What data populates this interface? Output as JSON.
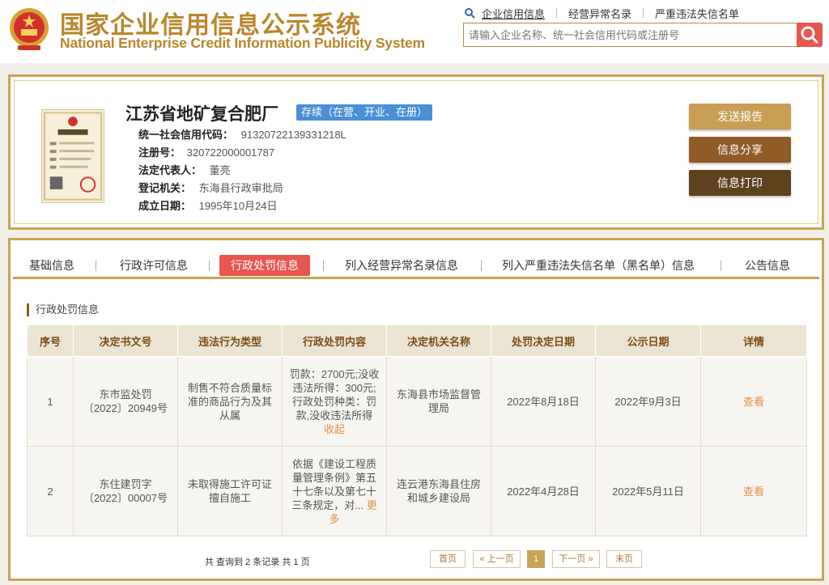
{
  "header": {
    "title_cn": "国家企业信用信息公示系统",
    "title_en": "National Enterprise Credit Information Publicity System",
    "links": [
      "企业信用信息",
      "经营异常名录",
      "严重违法失信名单"
    ],
    "search_placeholder": "请输入企业名称、统一社会信用代码或注册号"
  },
  "company": {
    "name": "江苏省地矿复合肥厂",
    "status": "存续（在营、开业、在册）",
    "fields": [
      {
        "label": "统一社会信用代码：",
        "value": "91320722139331218L"
      },
      {
        "label": "注册号：",
        "value": "320722000001787"
      },
      {
        "label": "法定代表人：",
        "value": "董亮"
      },
      {
        "label": "登记机关：",
        "value": "东海县行政审批局"
      },
      {
        "label": "成立日期：",
        "value": "1995年10月24日"
      }
    ],
    "actions": [
      "发送报告",
      "信息分享",
      "信息打印"
    ]
  },
  "tabs": [
    "基础信息",
    "行政许可信息",
    "行政处罚信息",
    "列入经营异常名录信息",
    "列入严重违法失信名单（黑名单）信息",
    "公告信息"
  ],
  "active_tab": "行政处罚信息",
  "section_title": "行政处罚信息",
  "table": {
    "headers": [
      "序号",
      "决定书文号",
      "违法行为类型",
      "行政处罚内容",
      "决定机关名称",
      "处罚决定日期",
      "公示日期",
      "详情"
    ],
    "rows": [
      {
        "no": "1",
        "doc": "东市监处罚〔2022〕20949号",
        "type": "制售不符合质量标准的商品行为及其从属",
        "content": "罚款：2700元;没收违法所得：300元;行政处罚种类：罚款,没收违法所得",
        "more": "收起",
        "authority": "东海县市场监督管理局",
        "decision_date": "2022年8月18日",
        "publish_date": "2022年9月3日",
        "detail": "查看"
      },
      {
        "no": "2",
        "doc": "东住建罚字〔2022〕00007号",
        "type": "未取得施工许可证擅自施工",
        "content": "依据《建设工程质量管理条例》第五十七条以及第七十三条规定，对...",
        "more": "更多",
        "authority": "连云港东海县住房和城乡建设局",
        "decision_date": "2022年4月28日",
        "publish_date": "2022年5月11日",
        "detail": "查看"
      }
    ]
  },
  "pager": {
    "total_text": "共 查询到 2 条记录 共 1 页",
    "first": "首页",
    "prev": "« 上一页",
    "current": "1",
    "next": "下一页 »",
    "last": "末页"
  },
  "colors": {
    "gold": "#c8a455",
    "title_gold": "#b8862b",
    "red_accent": "#e9554f",
    "status_blue": "#4a8fd8",
    "btn_send": "#c89f55",
    "btn_share": "#8f5b27",
    "btn_print": "#5e421d"
  },
  "icons": [
    "national-emblem-icon",
    "search-icon",
    "business-license-image"
  ]
}
